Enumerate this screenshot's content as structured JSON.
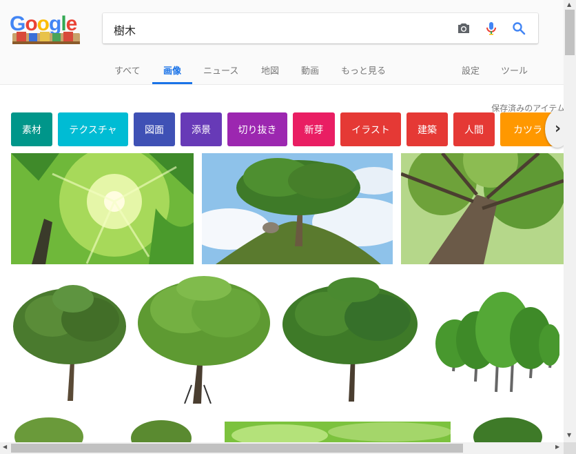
{
  "search": {
    "query": "樹木"
  },
  "tabs": [
    {
      "label": "すべて"
    },
    {
      "label": "画像"
    },
    {
      "label": "ニュース"
    },
    {
      "label": "地図"
    },
    {
      "label": "動画"
    },
    {
      "label": "もっと見る"
    },
    {
      "label": "設定"
    },
    {
      "label": "ツール"
    }
  ],
  "active_tab": "画像",
  "saved_link": "保存済みのアイテム",
  "chips": [
    {
      "label": "素材",
      "color": "#00968a"
    },
    {
      "label": "テクスチャ",
      "color": "#00bcd4"
    },
    {
      "label": "図面",
      "color": "#3f51b5"
    },
    {
      "label": "添景",
      "color": "#673ab7"
    },
    {
      "label": "切り抜き",
      "color": "#9c27b0"
    },
    {
      "label": "新芽",
      "color": "#e91e63"
    },
    {
      "label": "イラスト",
      "color": "#e53935"
    },
    {
      "label": "建築",
      "color": "#e53935"
    },
    {
      "label": "人間",
      "color": "#e53935"
    },
    {
      "label": "カツラ",
      "color": "#ff9800"
    }
  ],
  "icons": {
    "camera": "camera-icon",
    "mic": "mic-icon",
    "search": "search-icon",
    "chevron": "chevron-right-icon"
  },
  "colors": {
    "accent": "#1a73e8"
  }
}
